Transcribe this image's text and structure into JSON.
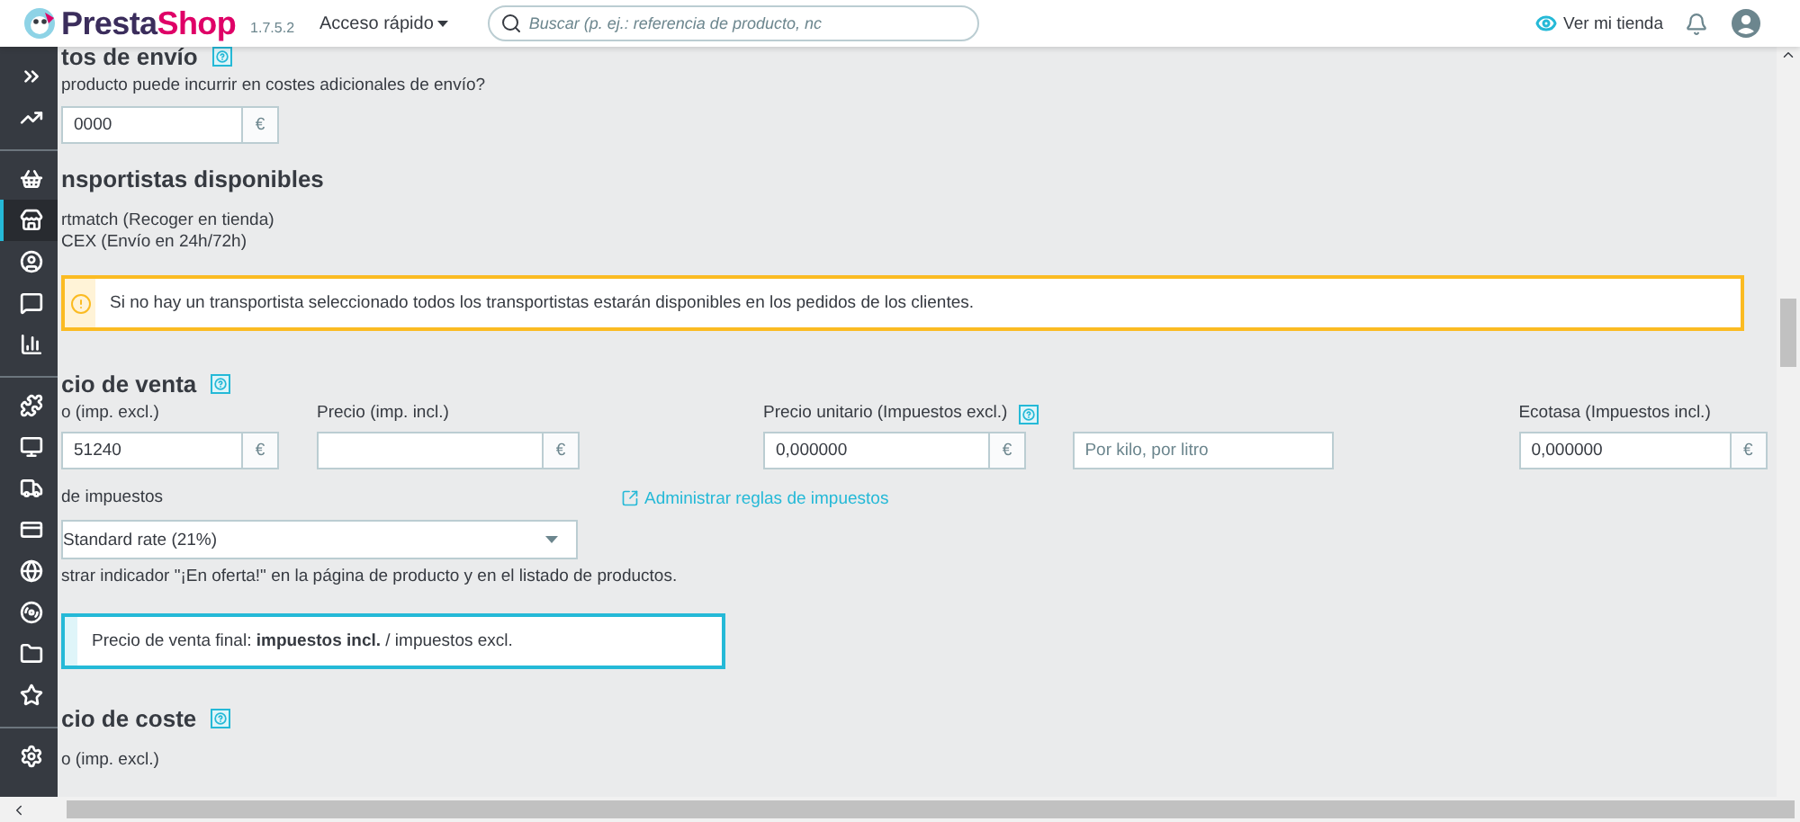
{
  "header": {
    "logo_brand": "Presta",
    "logo_accent": "Shop",
    "version": "1.7.5.2",
    "quick_access": "Acceso rápido",
    "search_placeholder": "Buscar (p. ej.: referencia de producto, nc",
    "view_store": "Ver mi tienda"
  },
  "sidebar": {
    "groups": [
      {
        "items": [
          {
            "selected": false
          },
          {
            "selected": false
          }
        ]
      },
      {
        "items": [
          {
            "selected": false
          },
          {
            "selected": true
          },
          {
            "selected": false
          },
          {
            "selected": false
          },
          {
            "selected": false
          }
        ]
      },
      {
        "items": [
          {
            "selected": false
          },
          {
            "selected": false
          },
          {
            "selected": false
          },
          {
            "selected": false
          },
          {
            "selected": false
          },
          {
            "selected": false
          },
          {
            "selected": false
          },
          {
            "selected": false
          }
        ]
      },
      {
        "items": [
          {
            "selected": false
          }
        ]
      }
    ]
  },
  "shipping": {
    "title": "tos de envío",
    "question": "producto puede incurrir en costes adicionales de envío?",
    "value": "0000",
    "currency": "€"
  },
  "carriers": {
    "title": "nsportistas disponibles",
    "items": [
      "rtmatch (Recoger en tienda)",
      "CEX (Envío en 24h/72h)"
    ]
  },
  "alert": {
    "text": "Si no hay un transportista seleccionado todos los transportistas estarán disponibles en los pedidos de los clientes."
  },
  "price": {
    "title": "cio de venta",
    "fields": [
      {
        "kind": "currency",
        "label": "o (imp. excl.)",
        "value": "51240",
        "currency": "€",
        "help": false
      },
      {
        "kind": "currency",
        "label": "Precio (imp. incl.)",
        "currency": "€",
        "help": false
      },
      {
        "kind": "currency",
        "label": "Precio unitario (Impuestos excl.)",
        "value": "0,000000",
        "currency": "€",
        "help": true
      },
      {
        "kind": "text",
        "placeholder": "Por kilo, por litro",
        "help": false
      },
      {
        "kind": "currency",
        "label": "Ecotasa (Impuestos incl.)",
        "value": "0,000000",
        "currency": "€",
        "help": false
      }
    ],
    "tax_label": "de impuestos",
    "tax_select": "Standard rate (21%)",
    "manage_link": "Administrar reglas de impuestos",
    "on_sale": "strar indicador \"¡En oferta!\" en la página de producto y en el listado de productos.",
    "final_price": "Precio de venta final: **impuestos incl.** / impuestos excl."
  },
  "cost": {
    "title": "cio de coste",
    "field_label": "o (imp. excl.)"
  }
}
